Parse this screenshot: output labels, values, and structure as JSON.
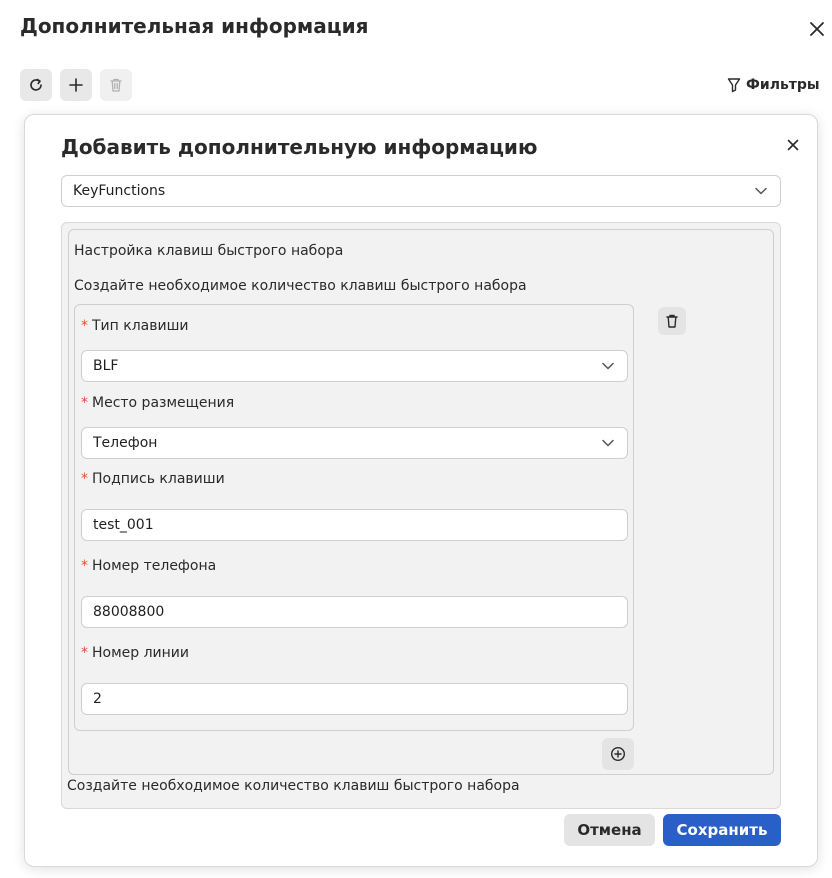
{
  "header": {
    "title": "Дополнительная информация",
    "filters_label": "Фильтры"
  },
  "toolbar": {
    "refresh": "refresh-icon",
    "add": "plus-icon",
    "delete": "trash-icon"
  },
  "modal": {
    "title": "Добавить дополнительную информацию",
    "type_select": "KeyFunctions",
    "section_title": "Настройка клавиш быстрого набора",
    "section_description": "Создайте необходимое количество клавиш быстрого набора",
    "footer_hint": "Создайте необходимое количество клавиш быстрого набора",
    "fields": {
      "key_type": {
        "label": "Тип клавиши",
        "value": "BLF"
      },
      "placement": {
        "label": "Место размещения",
        "value": "Телефон"
      },
      "key_caption": {
        "label": "Подпись клавиши",
        "value": "test_001"
      },
      "phone_number": {
        "label": "Номер телефона",
        "value": "88008800"
      },
      "line_number": {
        "label": "Номер линии",
        "value": "2"
      }
    },
    "cancel_label": "Отмена",
    "save_label": "Сохранить"
  },
  "colors": {
    "accent": "#2a5fc7",
    "required": "#e04a3a",
    "panel_bg": "#f2f2f2"
  }
}
